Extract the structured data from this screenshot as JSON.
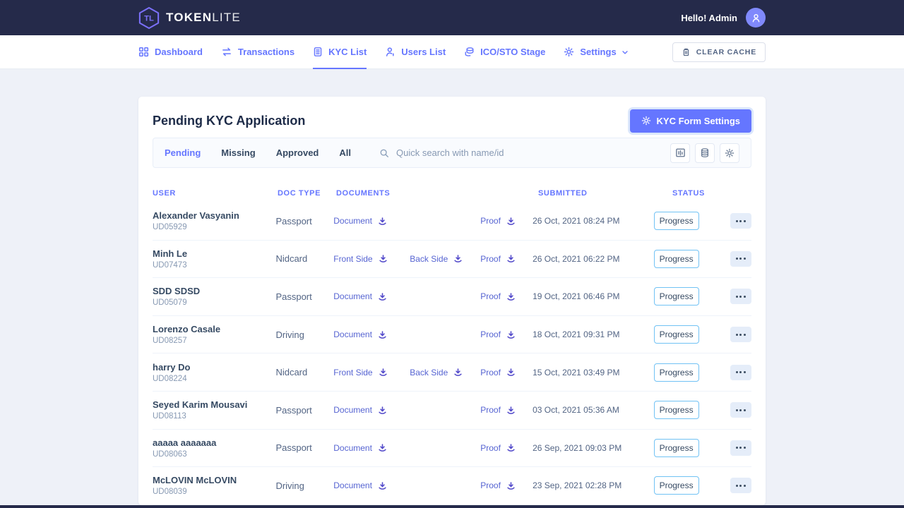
{
  "brand": {
    "bold": "TOKEN",
    "light": "LITE"
  },
  "topbar": {
    "greeting": "Hello! Admin"
  },
  "nav": {
    "items": [
      {
        "label": "Dashboard",
        "active": false
      },
      {
        "label": "Transactions",
        "active": false
      },
      {
        "label": "KYC List",
        "active": true
      },
      {
        "label": "Users List",
        "active": false
      },
      {
        "label": "ICO/STO Stage",
        "active": false
      },
      {
        "label": "Settings",
        "active": false
      }
    ],
    "clear_cache": "CLEAR CACHE"
  },
  "page": {
    "title": "Pending KYC Application",
    "kyc_form_settings": "KYC Form Settings"
  },
  "filters": {
    "tabs": [
      {
        "label": "Pending",
        "active": true
      },
      {
        "label": "Missing",
        "active": false
      },
      {
        "label": "Approved",
        "active": false
      },
      {
        "label": "All",
        "active": false
      }
    ],
    "search_placeholder": "Quick search with name/id"
  },
  "table": {
    "columns": [
      "USER",
      "DOC TYPE",
      "DOCUMENTS",
      "SUBMITTED",
      "STATUS"
    ],
    "rows": [
      {
        "name": "Alexander Vasyanin",
        "id": "UD05929",
        "doc_type": "Passport",
        "documents": [
          "Document"
        ],
        "proof": "Proof",
        "submitted": "26 Oct, 2021 08:24 PM",
        "status": "Progress"
      },
      {
        "name": "Minh Le",
        "id": "UD07473",
        "doc_type": "Nidcard",
        "documents": [
          "Front Side",
          "Back Side"
        ],
        "proof": "Proof",
        "submitted": "26 Oct, 2021 06:22 PM",
        "status": "Progress"
      },
      {
        "name": "SDD SDSD",
        "id": "UD05079",
        "doc_type": "Passport",
        "documents": [
          "Document"
        ],
        "proof": "Proof",
        "submitted": "19 Oct, 2021 06:46 PM",
        "status": "Progress"
      },
      {
        "name": "Lorenzo Casale",
        "id": "UD08257",
        "doc_type": "Driving",
        "documents": [
          "Document"
        ],
        "proof": "Proof",
        "submitted": "18 Oct, 2021 09:31 PM",
        "status": "Progress"
      },
      {
        "name": "harry Do",
        "id": "UD08224",
        "doc_type": "Nidcard",
        "documents": [
          "Front Side",
          "Back Side"
        ],
        "proof": "Proof",
        "submitted": "15 Oct, 2021 03:49 PM",
        "status": "Progress"
      },
      {
        "name": "Seyed Karim Mousavi",
        "id": "UD08113",
        "doc_type": "Passport",
        "documents": [
          "Document"
        ],
        "proof": "Proof",
        "submitted": "03 Oct, 2021 05:36 AM",
        "status": "Progress"
      },
      {
        "name": "aaaaa aaaaaaa",
        "id": "UD08063",
        "doc_type": "Passport",
        "documents": [
          "Document"
        ],
        "proof": "Proof",
        "submitted": "26 Sep, 2021 09:03 PM",
        "status": "Progress"
      },
      {
        "name": "McLOVIN McLOVIN",
        "id": "UD08039",
        "doc_type": "Driving",
        "documents": [
          "Document"
        ],
        "proof": "Proof",
        "submitted": "23 Sep, 2021 02:28 PM",
        "status": "Progress"
      }
    ]
  },
  "colors": {
    "accent": "#6576ff",
    "topbar_bg": "#252a4a",
    "page_bg": "#eef1f8",
    "link": "#5664d2",
    "badge_border": "#71c2f4",
    "text_dark": "#364a63",
    "text_muted": "#8799b3"
  }
}
